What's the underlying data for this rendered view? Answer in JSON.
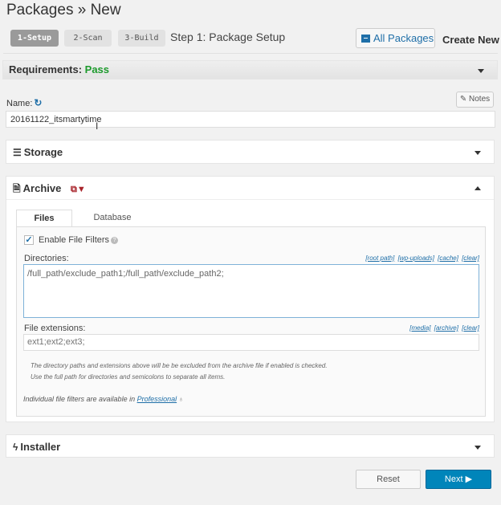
{
  "header": {
    "title": "Packages » New",
    "steps": [
      "1-Setup",
      "2-Scan",
      "3-Build"
    ],
    "step_title": "Step 1: Package Setup",
    "all_packages_label": "All Packages",
    "create_new_label": "Create New"
  },
  "requirements": {
    "label": "Requirements:",
    "status": "Pass",
    "status_color": "#1c9a2c"
  },
  "name_field": {
    "label": "Name:",
    "value": "20161122_itsmartytime",
    "notes_label": "Notes"
  },
  "panels": {
    "storage": {
      "title": "Storage",
      "icon": "database-icon"
    },
    "archive": {
      "title": "Archive",
      "icon": "file-archive-icon"
    },
    "installer": {
      "title": "Installer",
      "icon": "bolt-icon"
    }
  },
  "archive": {
    "tabs": [
      "Files",
      "Database"
    ],
    "active_tab": "Files",
    "enable_filters_label": "Enable File Filters",
    "enable_filters_checked": true,
    "directories_label": "Directories:",
    "directory_links": [
      "[root path]",
      "[wp-uploads]",
      "[cache]",
      "[clear]"
    ],
    "directories_value": "/full_path/exclude_path1;/full_path/exclude_path2;",
    "extensions_label": "File extensions:",
    "extension_links": [
      "[media]",
      "[archive]",
      "[clear]"
    ],
    "extensions_placeholder": "ext1;ext2;ext3;",
    "note_line1": "The directory paths and extensions above will be be excluded from the archive file if enabled is checked.",
    "note_line2": "Use the full path for directories and semicolons to separate all items.",
    "pro_text": "Individual file filters are available in",
    "pro_link": "Professional"
  },
  "footer": {
    "reset_label": "Reset",
    "next_label": "Next ▶",
    "next_color": "#0085ba"
  }
}
